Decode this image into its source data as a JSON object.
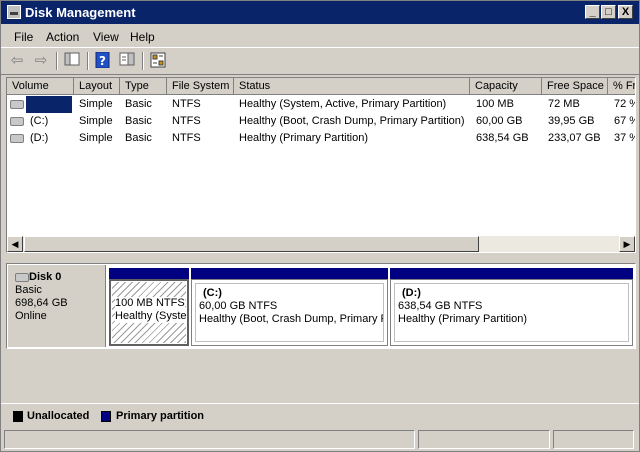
{
  "window": {
    "title": "Disk Management"
  },
  "titlebar": {
    "minimize": "_",
    "maximize": "□",
    "close": "X"
  },
  "menu": [
    "File",
    "Action",
    "View",
    "Help"
  ],
  "toolbar": {
    "icons": [
      "back-arrow-icon",
      "forward-arrow-icon",
      "console-tree-icon",
      "help-icon",
      "properties-icon",
      "settings-icon"
    ]
  },
  "columns": [
    "Volume",
    "Layout",
    "Type",
    "File System",
    "Status",
    "Capacity",
    "Free Space",
    "% Fr"
  ],
  "volumes": [
    {
      "volume": "",
      "layout": "Simple",
      "type": "Basic",
      "fs": "NTFS",
      "status": "Healthy (System, Active, Primary Partition)",
      "capacity": "100 MB",
      "free": "72 MB",
      "pct": "72 %"
    },
    {
      "volume": "(C:)",
      "layout": "Simple",
      "type": "Basic",
      "fs": "NTFS",
      "status": "Healthy (Boot, Crash Dump, Primary Partition)",
      "capacity": "60,00 GB",
      "free": "39,95 GB",
      "pct": "67 %"
    },
    {
      "volume": "(D:)",
      "layout": "Simple",
      "type": "Basic",
      "fs": "NTFS",
      "status": "Healthy (Primary Partition)",
      "capacity": "638,54 GB",
      "free": "233,07 GB",
      "pct": "37 %"
    }
  ],
  "disk": {
    "name": "Disk 0",
    "type": "Basic",
    "size": "698,64 GB",
    "state": "Online"
  },
  "partitions": [
    {
      "label": "",
      "size": "100 MB NTFS",
      "status": "Healthy (System, Active, Primary Partition)"
    },
    {
      "label": "(C:)",
      "size": "60,00 GB NTFS",
      "status": "Healthy (Boot, Crash Dump, Primary Partition)"
    },
    {
      "label": "(D:)",
      "size": "638,54 GB NTFS",
      "status": "Healthy (Primary Partition)"
    }
  ],
  "legend": {
    "unallocated": "Unallocated",
    "primary": "Primary partition",
    "unallocated_color": "#000000",
    "primary_color": "#000080"
  },
  "colors": {
    "titlebar": "#0a246a",
    "selection": "#0a246a",
    "partition_band": "#000080"
  }
}
